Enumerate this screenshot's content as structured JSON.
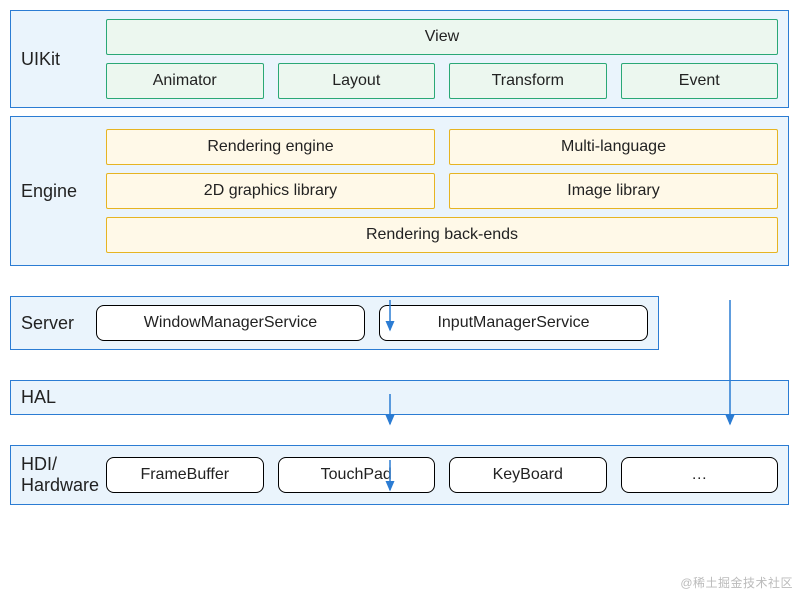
{
  "uikit": {
    "label": "UIKit",
    "view": "View",
    "animator": "Animator",
    "layout": "Layout",
    "transform": "Transform",
    "event": "Event"
  },
  "engine": {
    "label": "Engine",
    "rendering_engine": "Rendering engine",
    "multi_language": "Multi-language",
    "graphics2d": "2D graphics library",
    "image_library": "Image library",
    "rendering_backends": "Rendering back-ends"
  },
  "server": {
    "label": "Server",
    "window_manager": "WindowManagerService",
    "input_manager": "InputManagerService"
  },
  "hal": {
    "label": "HAL"
  },
  "hdi": {
    "label": "HDI/\nHardware",
    "framebuffer": "FrameBuffer",
    "touchpad": "TouchPad",
    "keyboard": "KeyBoard",
    "more": "…"
  },
  "watermark": "@稀土掘金技术社区"
}
